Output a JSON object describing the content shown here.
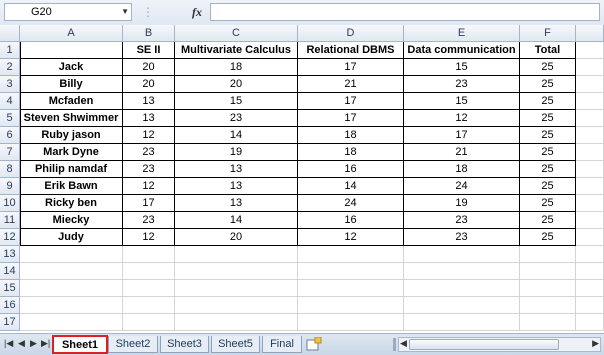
{
  "formula_bar": {
    "name_box": "G20",
    "fx_label": "fx",
    "formula": ""
  },
  "columns": [
    "A",
    "B",
    "C",
    "D",
    "E",
    "F"
  ],
  "rows": [
    "1",
    "2",
    "3",
    "4",
    "5",
    "6",
    "7",
    "8",
    "9",
    "10",
    "11",
    "12",
    "13",
    "14",
    "15",
    "16",
    "17"
  ],
  "table": {
    "header": [
      "",
      "SE II",
      "Multivariate Calculus",
      "Relational DBMS",
      "Data communication",
      "Total"
    ],
    "body": [
      [
        "Jack",
        "20",
        "18",
        "17",
        "15",
        "25"
      ],
      [
        "Billy",
        "20",
        "20",
        "21",
        "23",
        "25"
      ],
      [
        "Mcfaden",
        "13",
        "15",
        "17",
        "15",
        "25"
      ],
      [
        "Steven Shwimmer",
        "13",
        "23",
        "17",
        "12",
        "25"
      ],
      [
        "Ruby jason",
        "12",
        "14",
        "18",
        "17",
        "25"
      ],
      [
        "Mark Dyne",
        "23",
        "19",
        "18",
        "21",
        "25"
      ],
      [
        "Philip namdaf",
        "23",
        "13",
        "16",
        "18",
        "25"
      ],
      [
        "Erik Bawn",
        "12",
        "13",
        "14",
        "24",
        "25"
      ],
      [
        "Ricky ben",
        "17",
        "13",
        "24",
        "19",
        "25"
      ],
      [
        "Miecky",
        "23",
        "14",
        "16",
        "23",
        "25"
      ],
      [
        "Judy",
        "12",
        "20",
        "12",
        "23",
        "25"
      ]
    ]
  },
  "sheet_tabs": [
    "Sheet1",
    "Sheet2",
    "Sheet3",
    "Sheet5",
    "Final"
  ],
  "active_tab": "Sheet1",
  "colors": {
    "header_text": "#27415f",
    "grid_line": "#d4d4d4",
    "active_tab_border": "#e02020"
  }
}
